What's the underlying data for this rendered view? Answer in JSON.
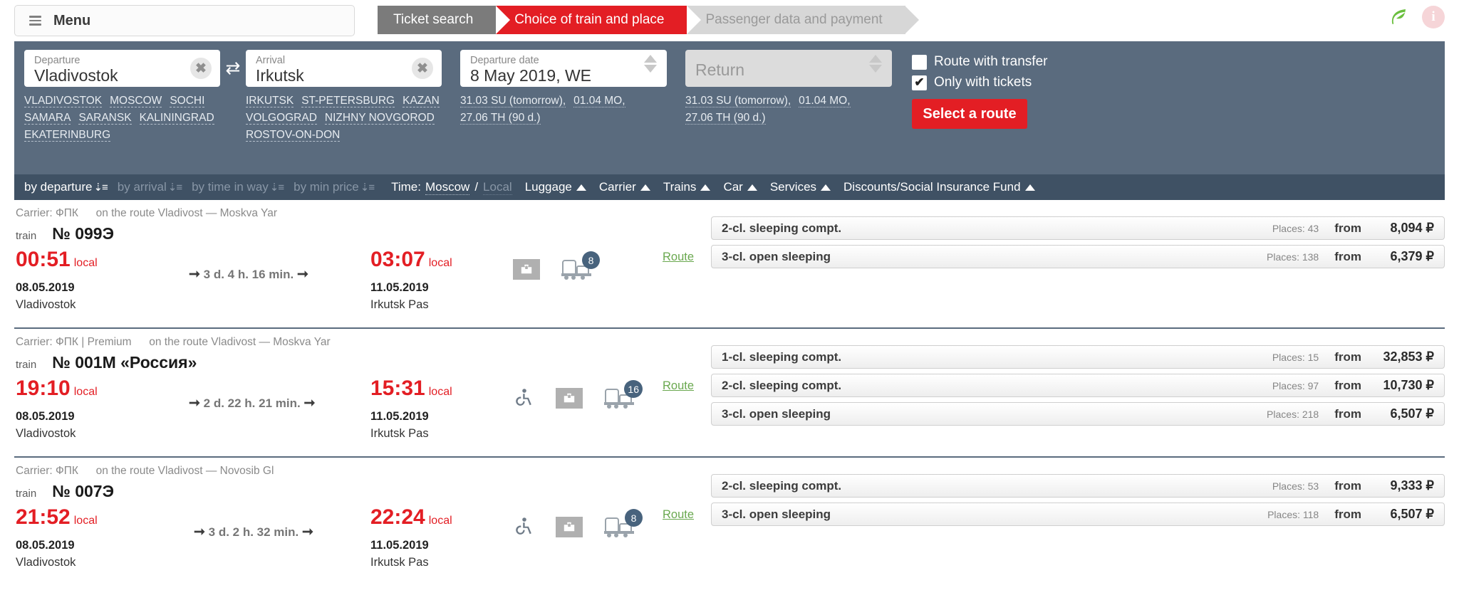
{
  "topbar": {
    "menu_label": "Menu",
    "steps": [
      {
        "label": "Ticket search",
        "state": "done"
      },
      {
        "label": "Choice of train and place",
        "state": "active"
      },
      {
        "label": "Passenger data and payment",
        "state": "todo"
      }
    ],
    "leaf_icon": "leaf-icon",
    "info_icon": "info-icon",
    "info_glyph": "i"
  },
  "search": {
    "departure": {
      "label": "Departure",
      "value": "Vladivostok",
      "clear_glyph": "✖",
      "suggestions": [
        "VLADIVOSTOK",
        "MOSCOW",
        "SOCHI",
        "SAMARA",
        "SARANSK",
        "KALININGRAD",
        "EKATERINBURG"
      ]
    },
    "swap_glyph": "⇄",
    "arrival": {
      "label": "Arrival",
      "value": "Irkutsk",
      "clear_glyph": "✖",
      "suggestions": [
        "IRKUTSK",
        "ST-PETERSBURG",
        "KAZAN",
        "VOLGOGRAD",
        "NIZHNY NOVGOROD",
        "ROSTOV-ON-DON"
      ]
    },
    "departure_date": {
      "label": "Departure date",
      "value": "8 May 2019, WE",
      "suggestions": [
        "31.03 SU (tomorrow),",
        "01.04 MO,",
        "27.06 TH (90 d.)"
      ]
    },
    "return_date": {
      "label": "",
      "placeholder": "Return",
      "suggestions": [
        "31.03 SU (tomorrow),",
        "01.04 MO,",
        "27.06 TH (90 d.)"
      ]
    },
    "options": [
      {
        "label": "Route with transfer",
        "checked": false
      },
      {
        "label": "Only with tickets",
        "checked": true
      }
    ],
    "submit_label": "Select a route",
    "accent_color": "#e31e24",
    "panel_color": "#5a6b7e"
  },
  "sortbar": {
    "sorts": [
      {
        "label": "by departure",
        "active": true
      },
      {
        "label": "by arrival",
        "active": false
      },
      {
        "label": "by time in way",
        "active": false
      },
      {
        "label": "by min price",
        "active": false
      }
    ],
    "time_label": "Time:",
    "time_moscow": "Moscow",
    "time_slash": "/",
    "time_local": "Local",
    "filters": [
      "Luggage",
      "Carrier",
      "Trains",
      "Car",
      "Services",
      "Discounts/Social Insurance Fund"
    ]
  },
  "results": {
    "carrier_prefix": "Carrier:",
    "train_label": "train",
    "route_link": "Route",
    "from_label": "from",
    "places_label": "Places:",
    "currency": "₽",
    "trains": [
      {
        "carrier": "ФПК",
        "route_text": "on the route Vladivost — Moskva Yar",
        "number": "№ 099Э",
        "dep_time": "00:51",
        "dep_time_zone": "local",
        "dep_date": "08.05.2019",
        "dep_station": "Vladivostok",
        "duration": "3 d. 4 h. 16 min.",
        "arr_time": "03:07",
        "arr_time_zone": "local",
        "arr_date": "11.05.2019",
        "arr_station": "Irkutsk Pas",
        "has_wheelchair": false,
        "has_luggage": true,
        "car_count": "8",
        "fares": [
          {
            "name": "2-cl. sleeping compt.",
            "places": "43",
            "price": "8,094"
          },
          {
            "name": "3-cl. open sleeping",
            "places": "138",
            "price": "6,379"
          }
        ]
      },
      {
        "carrier": "ФПК | Premium",
        "route_text": "on the route Vladivost — Moskva Yar",
        "number": "№ 001М «Россия»",
        "dep_time": "19:10",
        "dep_time_zone": "local",
        "dep_date": "08.05.2019",
        "dep_station": "Vladivostok",
        "duration": "2 d. 22 h. 21 min.",
        "arr_time": "15:31",
        "arr_time_zone": "local",
        "arr_date": "11.05.2019",
        "arr_station": "Irkutsk Pas",
        "has_wheelchair": true,
        "has_luggage": true,
        "car_count": "16",
        "fares": [
          {
            "name": "1-cl. sleeping compt.",
            "places": "15",
            "price": "32,853"
          },
          {
            "name": "2-cl. sleeping compt.",
            "places": "97",
            "price": "10,730"
          },
          {
            "name": "3-cl. open sleeping",
            "places": "218",
            "price": "6,507"
          }
        ]
      },
      {
        "carrier": "ФПК",
        "route_text": "on the route Vladivost — Novosib Gl",
        "number": "№ 007Э",
        "dep_time": "21:52",
        "dep_time_zone": "local",
        "dep_date": "08.05.2019",
        "dep_station": "Vladivostok",
        "duration": "3 d. 2 h. 32 min.",
        "arr_time": "22:24",
        "arr_time_zone": "local",
        "arr_date": "11.05.2019",
        "arr_station": "Irkutsk Pas",
        "has_wheelchair": true,
        "has_luggage": true,
        "car_count": "8",
        "fares": [
          {
            "name": "2-cl. sleeping compt.",
            "places": "53",
            "price": "9,333"
          },
          {
            "name": "3-cl. open sleeping",
            "places": "118",
            "price": "6,507"
          }
        ]
      }
    ]
  }
}
